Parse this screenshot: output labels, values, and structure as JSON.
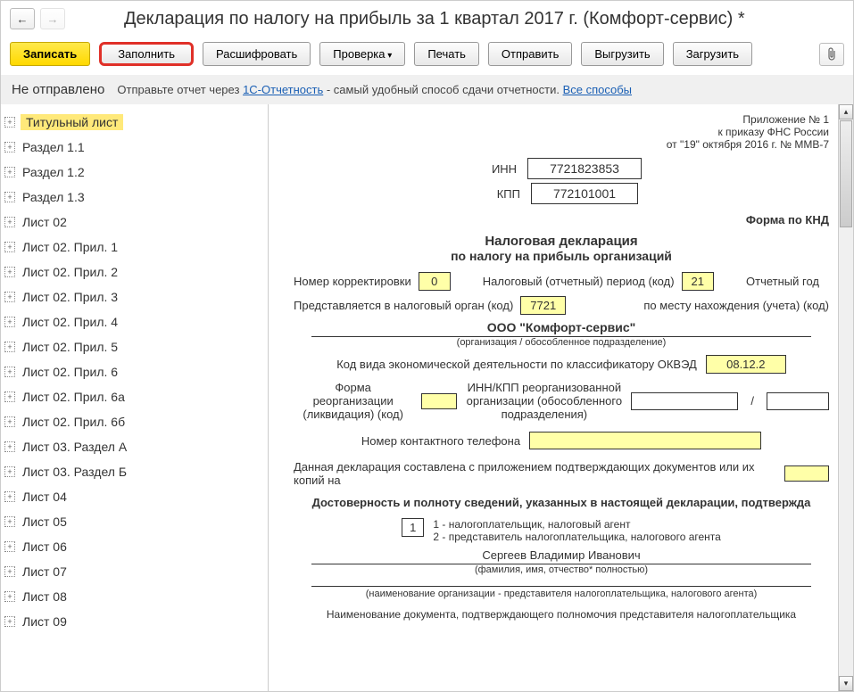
{
  "title": "Декларация по налогу на прибыль за 1 квартал 2017 г. (Комфорт-сервис) *",
  "toolbar": {
    "write": "Записать",
    "fill": "Заполнить",
    "decode": "Расшифровать",
    "check": "Проверка",
    "print": "Печать",
    "send": "Отправить",
    "export": "Выгрузить",
    "import": "Загрузить"
  },
  "status": {
    "label": "Не отправлено",
    "hint_prefix": "Отправьте отчет через ",
    "link1": "1С-Отчетность",
    "hint_mid": " - самый удобный способ сдачи отчетности. ",
    "link2": "Все способы"
  },
  "tree": [
    "Титульный лист",
    "Раздел 1.1",
    "Раздел 1.2",
    "Раздел 1.3",
    "Лист 02",
    "Лист 02. Прил. 1",
    "Лист 02. Прил. 2",
    "Лист 02. Прил. 3",
    "Лист 02. Прил. 4",
    "Лист 02. Прил. 5",
    "Лист 02. Прил. 6",
    "Лист 02. Прил. 6а",
    "Лист 02. Прил. 6б",
    "Лист 03. Раздел А",
    "Лист 03. Раздел Б",
    "Лист 04",
    "Лист 05",
    "Лист 06",
    "Лист 07",
    "Лист 08",
    "Лист 09"
  ],
  "doc": {
    "app_no": "Приложение № 1",
    "order": "к приказу ФНС России",
    "order_date": "от \"19\" октября 2016 г. № ММВ-7",
    "inn_label": "ИНН",
    "inn": "7721823853",
    "kpp_label": "КПП",
    "kpp": "772101001",
    "form_knd": "Форма по КНД",
    "decl_title": "Налоговая декларация",
    "decl_sub": "по налогу на прибыль организаций",
    "corr_label": "Номер корректировки",
    "corr": "0",
    "period_label": "Налоговый (отчетный) период (код)",
    "period": "21",
    "year_label": "Отчетный год",
    "organ_label": "Представляется в налоговый орган (код)",
    "organ": "7721",
    "place_label": "по месту нахождения (учета) (код)",
    "company": "ООО \"Комфорт-сервис\"",
    "company_note": "(организация / обособленное подразделение)",
    "okved_label": "Код вида экономической деятельности по классификатору ОКВЭД",
    "okved": "08.12.2",
    "reorg1": "Форма реорганизации (ликвидация) (код)",
    "reorg2": "ИНН/КПП реорганизованной организации (обособленного подразделения)",
    "phone_label": "Номер контактного телефона",
    "docs_label": "Данная декларация составлена с приложением подтверждающих документов или их копий на",
    "confirm": "Достоверность и полноту сведений, указанных в настоящей декларации, подтвержда",
    "code1": "1",
    "code_desc1": "1 - налогоплательщик, налоговый агент",
    "code_desc2": "2 - представитель налогоплательщика, налогового агента",
    "person": "Сергеев Владимир Иванович",
    "person_note": "(фамилия, имя, отчество* полностью)",
    "org_note": "(наименование организации - представителя налогоплательщика, налогового агента)",
    "footer": "Наименование документа, подтверждающего полномочия представителя налогоплательщика"
  }
}
